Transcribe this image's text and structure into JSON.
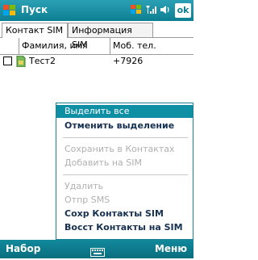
{
  "titlebar": {
    "title": "Пуск",
    "ok_label": "ok"
  },
  "tabs": [
    {
      "label": "Контакт SIM"
    },
    {
      "label": "Информация SIM"
    }
  ],
  "table": {
    "columns": [
      "Фамилия, имя",
      "Моб. тел."
    ],
    "rows": [
      {
        "name": "Тест2",
        "phone": "+7926"
      }
    ]
  },
  "context_menu": {
    "items": [
      {
        "label": "Выделить все",
        "state": "selected"
      },
      {
        "label": "Отменить выделение",
        "state": "enabled"
      },
      {
        "label": "Сохранить в Контактах",
        "state": "disabled"
      },
      {
        "label": "Добавить на SIM",
        "state": "disabled"
      },
      {
        "label": "Удалить",
        "state": "disabled"
      },
      {
        "label": "Отпр SMS",
        "state": "disabled"
      },
      {
        "label": "Сохр Контакты SIM",
        "state": "enabled"
      },
      {
        "label": "Восст Контакты на SIM",
        "state": "enabled"
      }
    ]
  },
  "softkeys": {
    "left": "Набор",
    "right": "Меню"
  },
  "icons": {
    "start": "windows-flag-icon",
    "status": [
      "windows-flag-icon",
      "signal-icon",
      "sound-icon"
    ],
    "keyboard": "keyboard-icon"
  },
  "colors": {
    "titlebar": "#0d7f93",
    "menu_highlight": "#0f8fa3",
    "menu_enabled_text": "#153050",
    "menu_disabled_text": "#b0b0b0"
  }
}
